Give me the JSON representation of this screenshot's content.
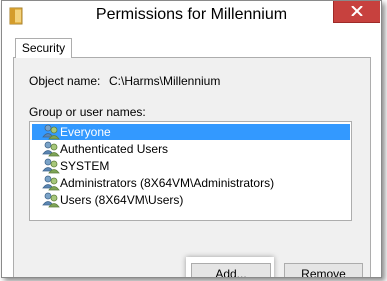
{
  "window": {
    "title": "Permissions for Millennium"
  },
  "tabs": [
    {
      "label": "Security",
      "active": true
    }
  ],
  "object": {
    "label": "Object name:",
    "value": "C:\\Harms\\Millennium"
  },
  "group_list": {
    "label": "Group or user names:",
    "items": [
      {
        "name": "Everyone",
        "selected": true,
        "icon": "user-group-icon"
      },
      {
        "name": "Authenticated Users",
        "selected": false,
        "icon": "user-group-icon"
      },
      {
        "name": "SYSTEM",
        "selected": false,
        "icon": "user-group-icon"
      },
      {
        "name": "Administrators (8X64VM\\Administrators)",
        "selected": false,
        "icon": "user-group-icon"
      },
      {
        "name": "Users (8X64VM\\Users)",
        "selected": false,
        "icon": "user-group-icon"
      }
    ]
  },
  "buttons": {
    "add": "Add...",
    "remove": "Remove"
  },
  "colors": {
    "close_button": "#c7413e",
    "selection": "#3399ff",
    "panel": "#f0f0f0"
  }
}
